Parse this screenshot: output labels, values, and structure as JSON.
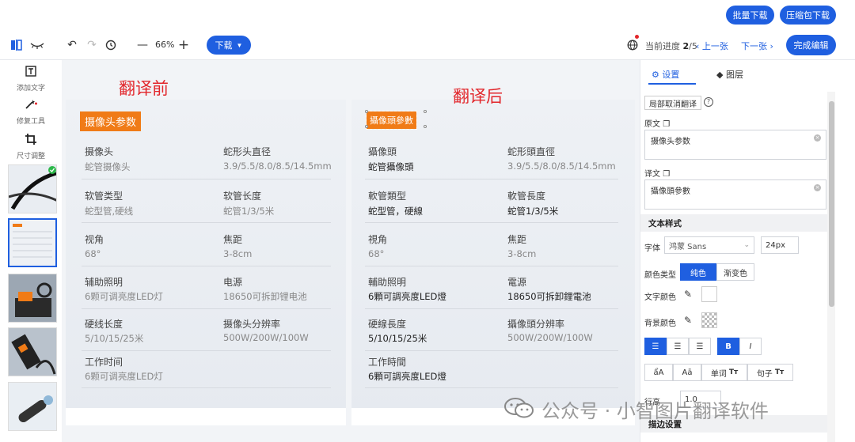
{
  "top_actions": {
    "batch_download": "批量下载",
    "zip_download": "压缩包下载"
  },
  "toolbar": {
    "zoom": "66%",
    "download": "下载",
    "progress_label": "当前进度",
    "progress_current": "2",
    "progress_total": "/5",
    "prev": "上一张",
    "next": "下一张",
    "finish": "完成编辑"
  },
  "left_tools": [
    {
      "label": "添加文字",
      "icon": "text-box-icon"
    },
    {
      "label": "修复工具",
      "icon": "magic-wand-icon"
    },
    {
      "label": "尺寸调整",
      "icon": "crop-icon"
    }
  ],
  "canvas": {
    "before_title": "翻译前",
    "after_title": "翻译后",
    "before_badge": "摄像头参数",
    "after_badge": "攝像頭參數",
    "before_rows": [
      {
        "k1": "摄像头",
        "v1": "蛇管摄像头",
        "k2": "蛇形头直径",
        "v2": "3.9/5.5/8.0/8.5/14.5mm"
      },
      {
        "k1": "软管类型",
        "v1": "蛇型管,硬线",
        "k2": "软管长度",
        "v2": "蛇管1/3/5米"
      },
      {
        "k1": "视角",
        "v1": "68°",
        "k2": "焦距",
        "v2": "3-8cm"
      },
      {
        "k1": "辅助照明",
        "v1": "6颗可调亮度LED灯",
        "k2": "电源",
        "v2": "18650可拆卸锂电池"
      },
      {
        "k1": "硬线长度",
        "v1": "5/10/15/25米",
        "k2": "摄像头分辨率",
        "v2": "500W/200W/100W"
      },
      {
        "k1": "工作时间",
        "v1": "6颗可调亮度LED灯",
        "k2": "",
        "v2": ""
      }
    ],
    "after_rows": [
      {
        "k1": "攝像頭",
        "v1": "蛇管攝像頭",
        "k2": "蛇形頭直徑",
        "v2": "3.9/5.5/8.0/8.5/14.5mm"
      },
      {
        "k1": "軟管類型",
        "v1": "蛇型管，硬線",
        "k2": "軟管長度",
        "v2": "蛇管1/3/5米"
      },
      {
        "k1": "視角",
        "v1": "68°",
        "k2": "焦距",
        "v2": "3-8cm"
      },
      {
        "k1": "輔助照明",
        "v1": "6顆可調亮度LED燈",
        "k2": "電源",
        "v2": "18650可拆卸鋰電池"
      },
      {
        "k1": "硬線長度",
        "v1": "5/10/15/25米",
        "k2": "攝像頭分辨率",
        "v2": "500W/200W/100W"
      },
      {
        "k1": "工作時間",
        "v1": "6顆可調亮度LED燈",
        "k2": "",
        "v2": ""
      }
    ]
  },
  "right_panel": {
    "tab_settings": "设置",
    "tab_layers": "图层",
    "partial_cancel": "局部取消翻译",
    "original_label": "原文",
    "original_text": "摄像头参数",
    "translation_label": "译文",
    "translation_text": "攝像頭參數",
    "text_style_head": "文本样式",
    "font_label": "字体",
    "font_value": "鸿蒙 Sans",
    "font_size": "24px",
    "color_type_label": "颜色类型",
    "solid": "纯色",
    "gradient": "渐变色",
    "text_color_label": "文字颜色",
    "bg_color_label": "背景颜色",
    "bold": "B",
    "italic": "I",
    "case_upper": "ẩA",
    "case_cap": "Aā",
    "word": "单词",
    "sentence": "句子",
    "line_height_label": "行高",
    "line_height_value": "1.0",
    "stroke_head": "描边设置"
  },
  "watermark": {
    "text": "公众号 · 小智图片翻译软件"
  },
  "colors": {
    "accent": "#1f5fe0",
    "badge": "#f07b17",
    "title_red": "#e2262b"
  }
}
